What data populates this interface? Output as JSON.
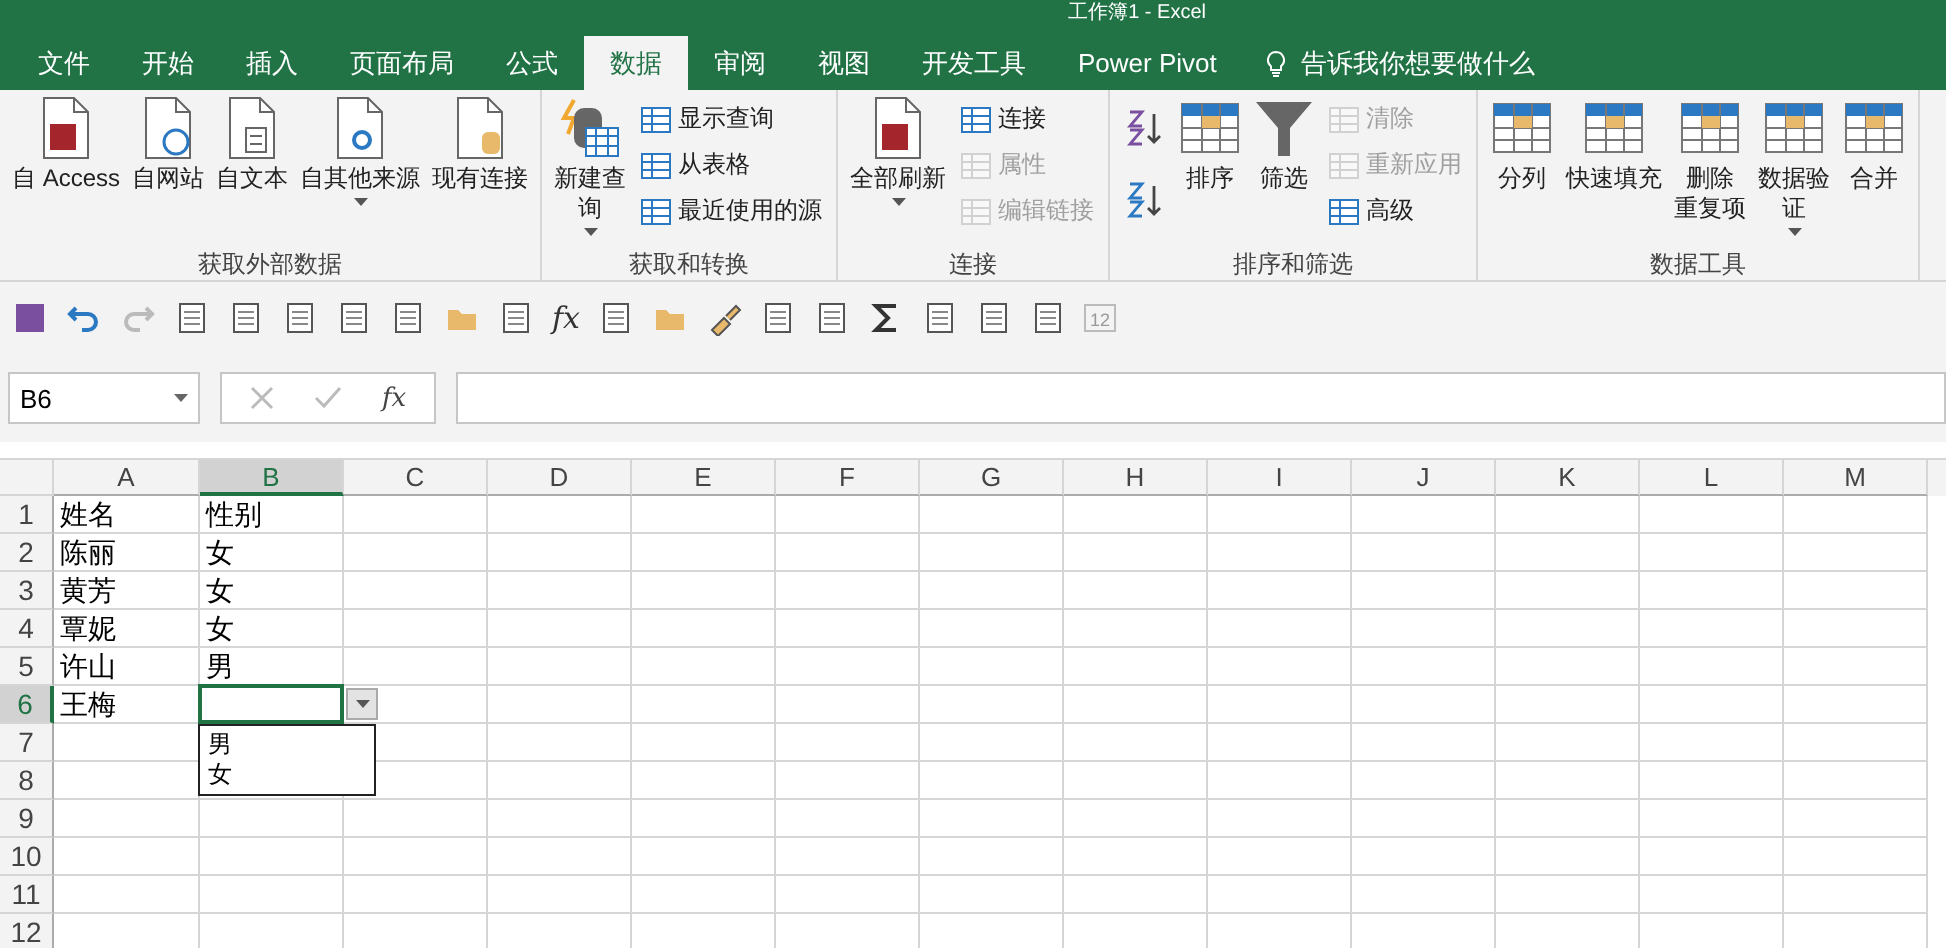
{
  "window": {
    "title": "工作簿1 - Excel"
  },
  "tabs": [
    {
      "label": "文件",
      "selected": false
    },
    {
      "label": "开始",
      "selected": false
    },
    {
      "label": "插入",
      "selected": false
    },
    {
      "label": "页面布局",
      "selected": false
    },
    {
      "label": "公式",
      "selected": false
    },
    {
      "label": "数据",
      "selected": true
    },
    {
      "label": "审阅",
      "selected": false
    },
    {
      "label": "视图",
      "selected": false
    },
    {
      "label": "开发工具",
      "selected": false
    },
    {
      "label": "Power Pivot",
      "selected": false
    }
  ],
  "tell_me": {
    "placeholder": "告诉我你想要做什么"
  },
  "ribbon_groups": [
    {
      "label": "获取外部数据",
      "items": [
        {
          "kind": "large",
          "lines": [
            "自 Access"
          ],
          "disabled": false,
          "has_menu": false
        },
        {
          "kind": "large",
          "lines": [
            "自网站"
          ],
          "disabled": false,
          "has_menu": false
        },
        {
          "kind": "large",
          "lines": [
            "自文本"
          ],
          "disabled": false,
          "has_menu": false
        },
        {
          "kind": "large",
          "lines": [
            "自其他来源"
          ],
          "disabled": false,
          "has_menu": true
        },
        {
          "kind": "large",
          "lines": [
            "现有连接"
          ],
          "disabled": false,
          "has_menu": false
        }
      ]
    },
    {
      "label": "获取和转换",
      "items": [
        {
          "kind": "large",
          "lines": [
            "新建查",
            "询"
          ],
          "disabled": false,
          "has_menu": true
        },
        {
          "kind": "small",
          "lines": [
            "显示查询"
          ],
          "disabled": false
        },
        {
          "kind": "small",
          "lines": [
            "从表格"
          ],
          "disabled": false
        },
        {
          "kind": "small",
          "lines": [
            "最近使用的源"
          ],
          "disabled": false
        }
      ]
    },
    {
      "label": "连接",
      "items": [
        {
          "kind": "large",
          "lines": [
            "全部刷新"
          ],
          "disabled": false,
          "has_menu": true
        },
        {
          "kind": "small",
          "lines": [
            "连接"
          ],
          "disabled": false
        },
        {
          "kind": "small",
          "lines": [
            "属性"
          ],
          "disabled": true
        },
        {
          "kind": "small",
          "lines": [
            "编辑链接"
          ],
          "disabled": true
        }
      ]
    },
    {
      "label": "排序和筛选",
      "items": [
        {
          "kind": "sort"
        },
        {
          "kind": "large",
          "lines": [
            "排序"
          ],
          "disabled": false,
          "has_menu": false
        },
        {
          "kind": "large",
          "lines": [
            "筛选"
          ],
          "disabled": false,
          "has_menu": false
        },
        {
          "kind": "small",
          "lines": [
            "清除"
          ],
          "disabled": true
        },
        {
          "kind": "small",
          "lines": [
            "重新应用"
          ],
          "disabled": true
        },
        {
          "kind": "small",
          "lines": [
            "高级"
          ],
          "disabled": false
        }
      ]
    },
    {
      "label": "数据工具",
      "items": [
        {
          "kind": "large",
          "lines": [
            "分列"
          ],
          "disabled": false,
          "has_menu": false
        },
        {
          "kind": "large",
          "lines": [
            "快速填充"
          ],
          "disabled": false,
          "has_menu": false
        },
        {
          "kind": "large",
          "lines": [
            "删除",
            "重复项"
          ],
          "disabled": false,
          "has_menu": false
        },
        {
          "kind": "large",
          "lines": [
            "数据验",
            "证"
          ],
          "disabled": false,
          "has_menu": true
        },
        {
          "kind": "large",
          "lines": [
            "合并"
          ],
          "disabled": false,
          "has_menu": false
        }
      ]
    }
  ],
  "quick_access": {
    "function_label": "fx",
    "paste_count": "12"
  },
  "formula_bar": {
    "name_box": "B6",
    "function_label": "fx"
  },
  "columns": [
    {
      "label": "A",
      "selected": false
    },
    {
      "label": "B",
      "selected": true
    },
    {
      "label": "C",
      "selected": false
    },
    {
      "label": "D",
      "selected": false
    },
    {
      "label": "E",
      "selected": false
    },
    {
      "label": "F",
      "selected": false
    },
    {
      "label": "G",
      "selected": false
    },
    {
      "label": "H",
      "selected": false
    },
    {
      "label": "I",
      "selected": false
    },
    {
      "label": "J",
      "selected": false
    },
    {
      "label": "K",
      "selected": false
    },
    {
      "label": "L",
      "selected": false
    },
    {
      "label": "M",
      "selected": false
    }
  ],
  "rows": [
    {
      "number": "1",
      "selected": false,
      "cells": [
        "姓名",
        "性别"
      ]
    },
    {
      "number": "2",
      "selected": false,
      "cells": [
        "陈丽",
        "女"
      ]
    },
    {
      "number": "3",
      "selected": false,
      "cells": [
        "黄芳",
        "女"
      ]
    },
    {
      "number": "4",
      "selected": false,
      "cells": [
        "覃妮",
        "女"
      ]
    },
    {
      "number": "5",
      "selected": false,
      "cells": [
        "许山",
        "男"
      ]
    },
    {
      "number": "6",
      "selected": true,
      "cells": [
        "王梅"
      ]
    },
    {
      "number": "7",
      "selected": false
    },
    {
      "number": "8",
      "selected": false
    },
    {
      "number": "9",
      "selected": false
    },
    {
      "number": "10",
      "selected": false
    },
    {
      "number": "11",
      "selected": false
    },
    {
      "number": "12",
      "selected": false
    }
  ],
  "dropdown": {
    "options": [
      {
        "label": "男"
      },
      {
        "label": "女"
      }
    ]
  }
}
